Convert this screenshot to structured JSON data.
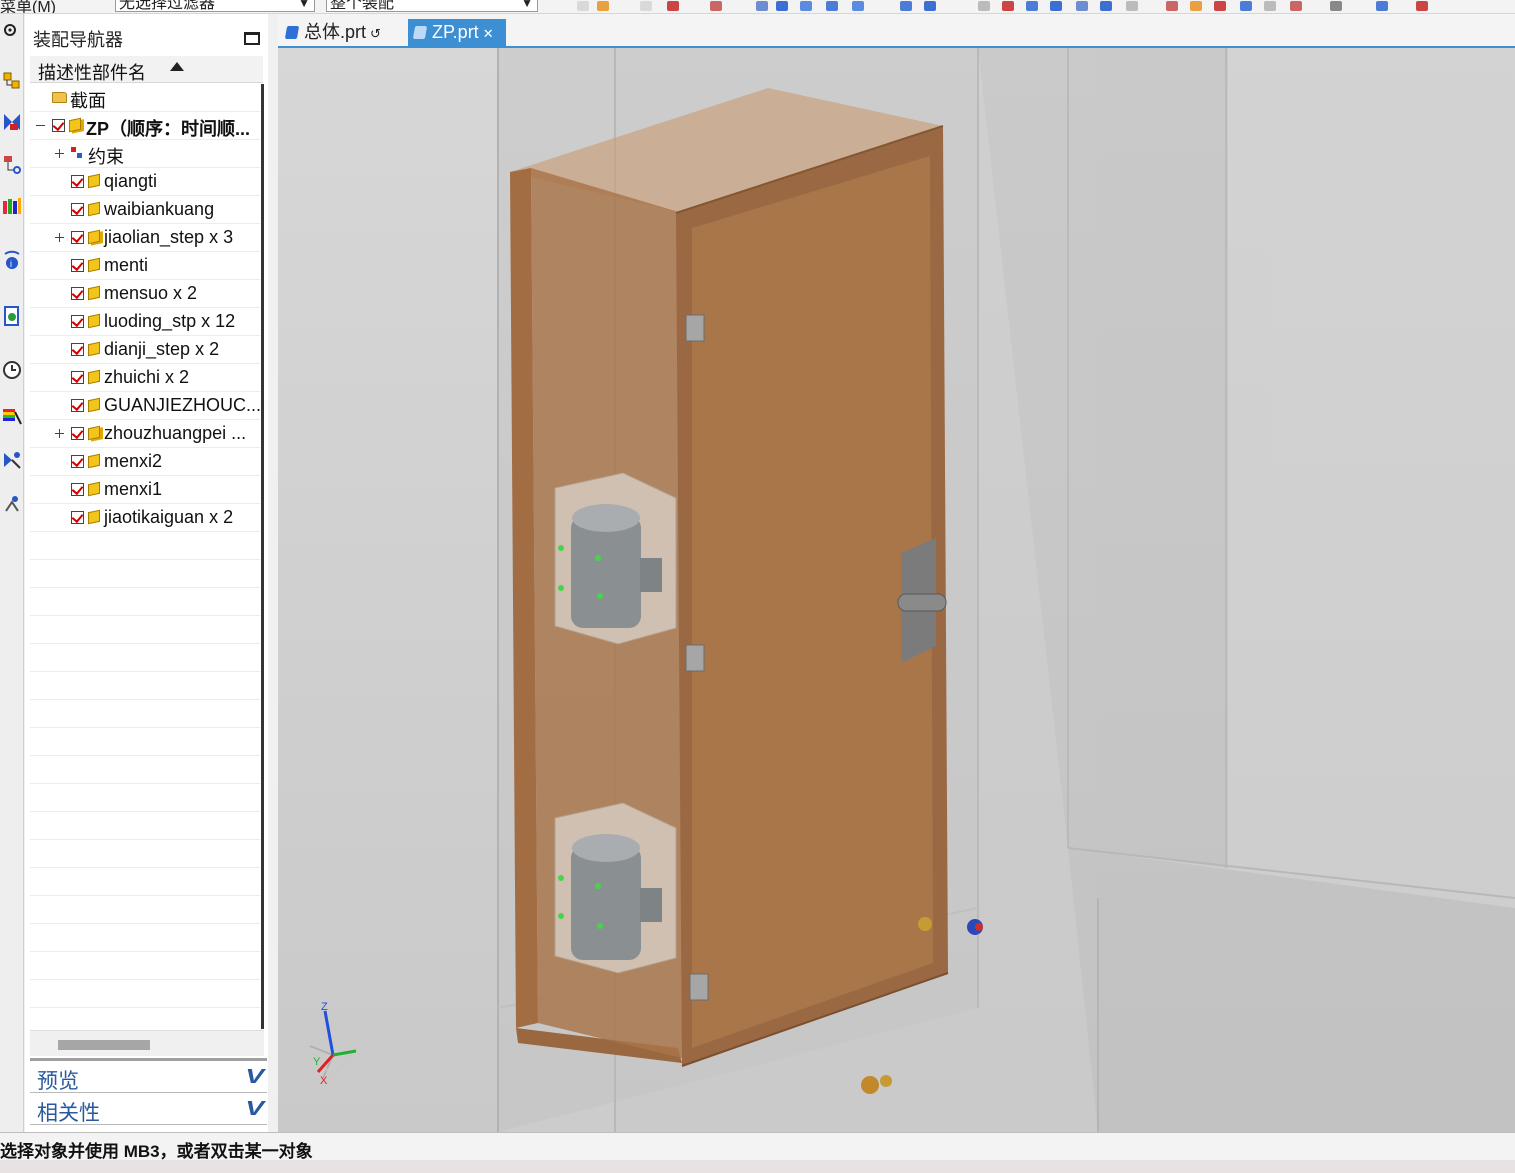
{
  "toolbar": {
    "menu_label": "菜单(M)",
    "filter_value": "无选择过滤器",
    "scope_value": "整个装配"
  },
  "navigator": {
    "title": "装配导航器",
    "column_header": "描述性部件名",
    "items": [
      {
        "label": "截面",
        "type": "folder"
      },
      {
        "label": "ZP（顺序：时间顺...",
        "type": "root"
      },
      {
        "label": "约束",
        "type": "constraints"
      },
      {
        "label": "qiangti",
        "type": "part"
      },
      {
        "label": "waibiankuang",
        "type": "part"
      },
      {
        "label": "jiaolian_step x 3",
        "type": "subassembly"
      },
      {
        "label": "menti",
        "type": "part"
      },
      {
        "label": "mensuo x 2",
        "type": "part"
      },
      {
        "label": "luoding_stp x 12",
        "type": "part"
      },
      {
        "label": "dianji_step x 2",
        "type": "part"
      },
      {
        "label": "zhuichi x 2",
        "type": "part"
      },
      {
        "label": "GUANJIEZHOUC...",
        "type": "part"
      },
      {
        "label": "zhouzhuangpei ...",
        "type": "subassembly"
      },
      {
        "label": "menxi2",
        "type": "part"
      },
      {
        "label": "menxi1",
        "type": "part"
      },
      {
        "label": "jiaotikaiguan x 2",
        "type": "part"
      }
    ],
    "panels": {
      "preview": "预览",
      "dependencies": "相关性"
    }
  },
  "tabs": [
    {
      "label": "总体.prt",
      "active": false
    },
    {
      "label": "ZP.prt",
      "active": true
    }
  ],
  "triad": {
    "x": "X",
    "y": "Y",
    "z": "Z"
  },
  "status": {
    "prompt": "选择对象并使用 MB3，或者双击某一对象"
  },
  "colors": {
    "accent": "#3d8fd4",
    "door": "#a87448",
    "viewport_bg": "#cfcfcf"
  }
}
